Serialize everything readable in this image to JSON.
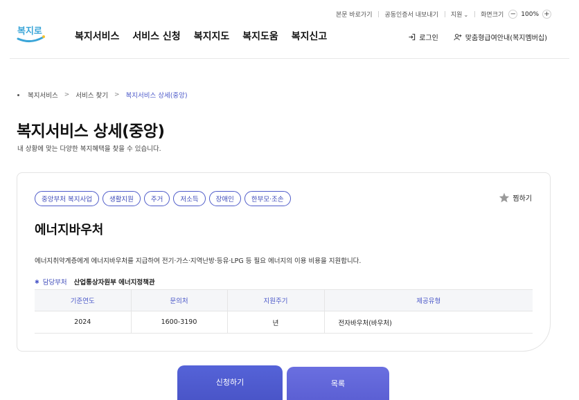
{
  "util": {
    "skip": "본문 바로가기",
    "cert": "공동인증서 내보내기",
    "support": "지원",
    "zoom_label": "화면크기",
    "zoom_value": "100%"
  },
  "logo": {
    "text": "복지로"
  },
  "gnb": [
    "복지서비스",
    "서비스 신청",
    "복지지도",
    "복지도움",
    "복지신고"
  ],
  "auth": {
    "login": "로그인",
    "membership": "맞춤형급여안내(복지멤버십)"
  },
  "breadcrumb": [
    "복지서비스",
    "서비스 찾기",
    "복지서비스 상세(중앙)"
  ],
  "page": {
    "title": "복지서비스 상세(중앙)",
    "subtitle": "내 상황에 맞는 다양한 복지혜택을 찾을 수 있습니다."
  },
  "service": {
    "tags": [
      "중앙부처 복지사업",
      "생활지원",
      "주거",
      "저소득",
      "장애인",
      "한부모·조손"
    ],
    "favorite": "찜하기",
    "name": "에너지바우처",
    "description": "에너지취약계층에게 에너지바우처를 지급하여 전기·가스·지역난방·등유·LPG 등 필요 에너지의 이용 비용을 지원합니다.",
    "dept_label": "담당부처",
    "dept_value": "산업통상자원부 에너지정책관",
    "table": {
      "headers": [
        "기준연도",
        "문의처",
        "지원주기",
        "제공유형"
      ],
      "row": [
        "2024",
        "1600-3190",
        "년",
        "전자바우처(바우처)"
      ]
    }
  },
  "buttons": {
    "apply": "신청하기",
    "list": "목록"
  },
  "colors": {
    "accent": "#4a57c8"
  }
}
